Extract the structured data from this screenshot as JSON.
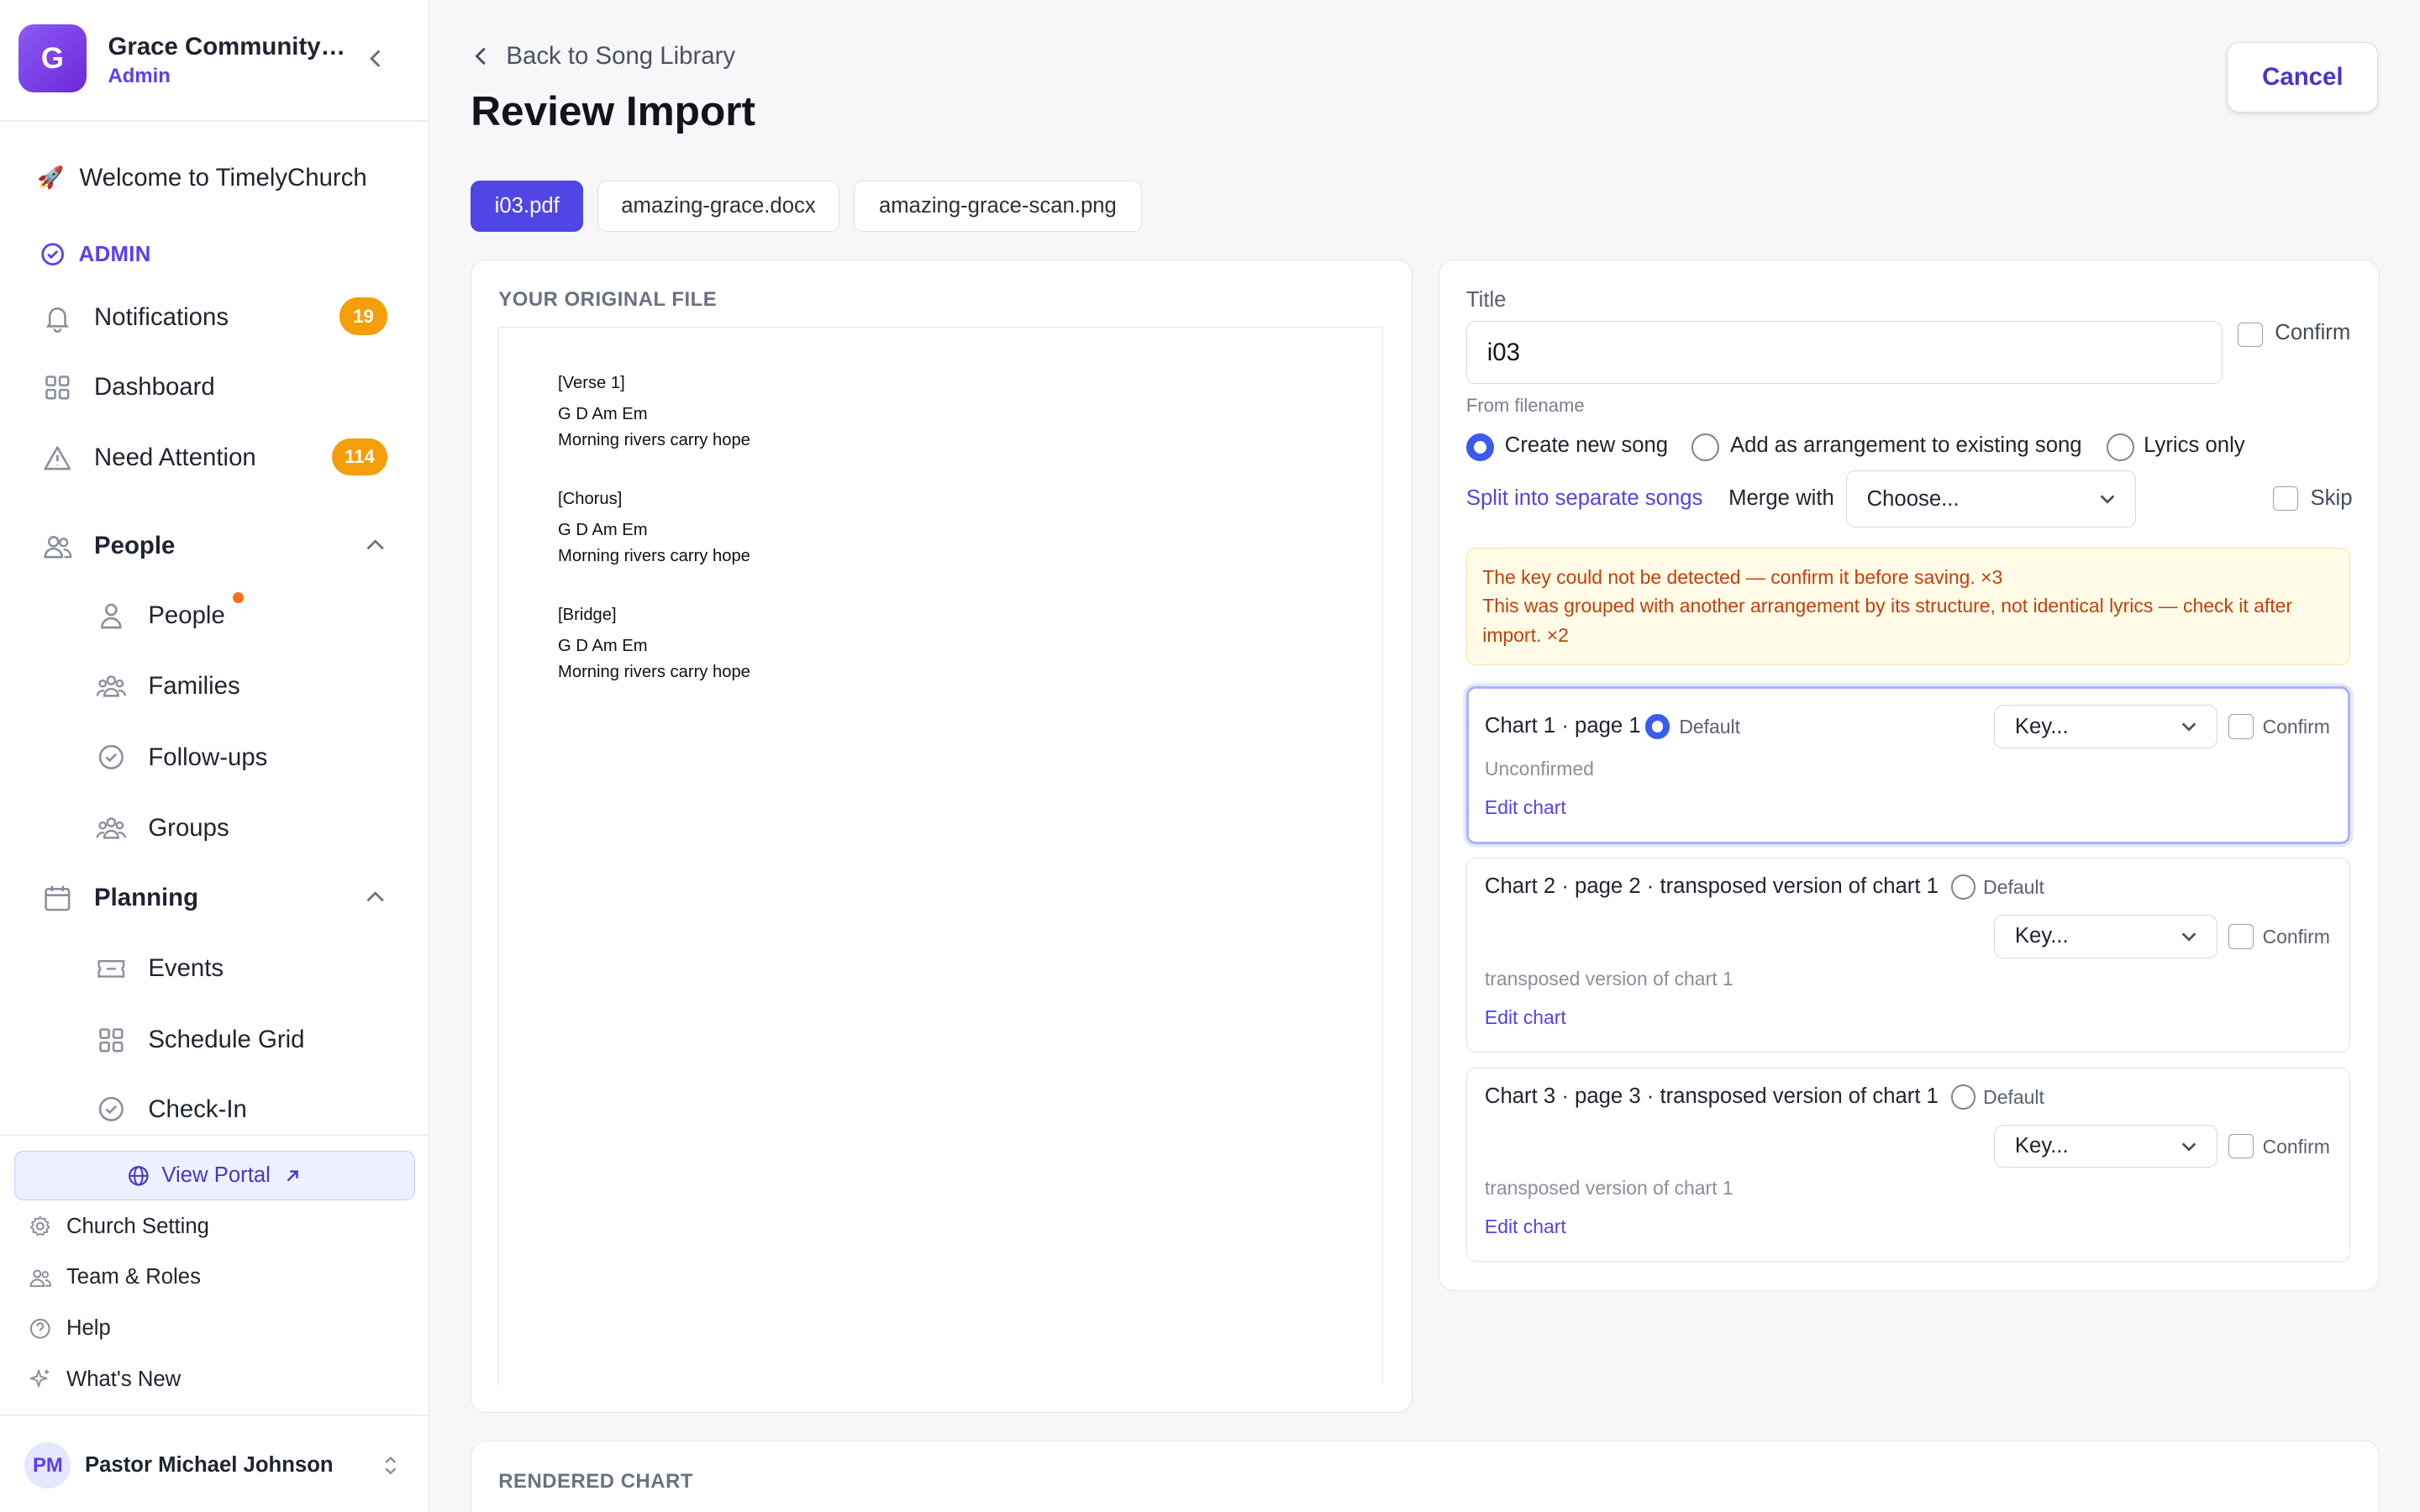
{
  "sidebar": {
    "org_initial": "G",
    "org_name": "Grace Community Church",
    "org_role": "Admin",
    "welcome": "Welcome to TimelyChurch",
    "admin_section": "ADMIN",
    "items": [
      {
        "label": "Notifications",
        "badge": "19",
        "icon": "bell-icon"
      },
      {
        "label": "Dashboard",
        "icon": "grid-icon"
      },
      {
        "label": "Need Attention",
        "badge": "114",
        "icon": "warning-icon"
      }
    ],
    "people_group": {
      "label": "People",
      "items": [
        {
          "label": "People",
          "icon": "person-icon"
        },
        {
          "label": "Families",
          "icon": "family-icon"
        },
        {
          "label": "Follow-ups",
          "icon": "check-circle-icon"
        },
        {
          "label": "Groups",
          "icon": "groups-icon"
        }
      ]
    },
    "planning_group": {
      "label": "Planning",
      "items": [
        {
          "label": "Events",
          "icon": "ticket-icon"
        },
        {
          "label": "Schedule Grid",
          "icon": "grid-icon"
        },
        {
          "label": "Check-In",
          "icon": "check-circle-icon"
        }
      ]
    },
    "view_portal": "View Portal",
    "footer": [
      {
        "label": "Church Setting",
        "icon": "gear-icon"
      },
      {
        "label": "Team & Roles",
        "icon": "team-icon"
      },
      {
        "label": "Help",
        "icon": "help-icon"
      },
      {
        "label": "What's New",
        "icon": "sparkle-icon"
      }
    ],
    "user_initials": "PM",
    "user_name": "Pastor Michael Johnson"
  },
  "header": {
    "back": "Back to Song Library",
    "title": "Review Import",
    "cancel": "Cancel"
  },
  "files": [
    "i03.pdf",
    "amazing-grace.docx",
    "amazing-grace-scan.png"
  ],
  "active_file": "i03.pdf",
  "original": {
    "label": "YOUR ORIGINAL FILE",
    "lines": [
      "[Verse 1]",
      "G D Am Em",
      "Morning rivers carry hope",
      "[Chorus]",
      "G D Am Em",
      "Morning rivers carry hope",
      "[Bridge]",
      "G D Am Em",
      "Morning rivers carry hope"
    ]
  },
  "form": {
    "title_label": "Title",
    "title_value": "i03",
    "confirm": "Confirm",
    "from_filename": "From filename",
    "mode_options": [
      "Create new song",
      "Add as arrangement to existing song",
      "Lyrics only"
    ],
    "mode_selected": "Create new song",
    "split_link": "Split into separate songs",
    "merge_label": "Merge with",
    "merge_value": "Choose...",
    "skip": "Skip",
    "warnings": [
      "The key could not be detected — confirm it before saving. ×3",
      "This was grouped with another arrangement by its structure, not identical lyrics — check it after import. ×2"
    ]
  },
  "charts": [
    {
      "title": "Chart 1 · page 1",
      "default": "Default",
      "is_default": true,
      "key": "Key...",
      "confirm": "Confirm",
      "status": "Unconfirmed",
      "edit": "Edit chart"
    },
    {
      "title": "Chart 2 · page 2 · transposed version of chart 1",
      "default": "Default",
      "is_default": false,
      "key": "Key...",
      "confirm": "Confirm",
      "status": "transposed version of chart 1",
      "edit": "Edit chart"
    },
    {
      "title": "Chart 3 · page 3 · transposed version of chart 1",
      "default": "Default",
      "is_default": false,
      "key": "Key...",
      "confirm": "Confirm",
      "status": "transposed version of chart 1",
      "edit": "Edit chart"
    }
  ],
  "rendered": {
    "label": "RENDERED CHART"
  },
  "colors": {
    "accent": "#4f46e5",
    "badge": "#f59e0b",
    "warning_text": "#c2410c",
    "warning_bg": "#fffbe6"
  }
}
